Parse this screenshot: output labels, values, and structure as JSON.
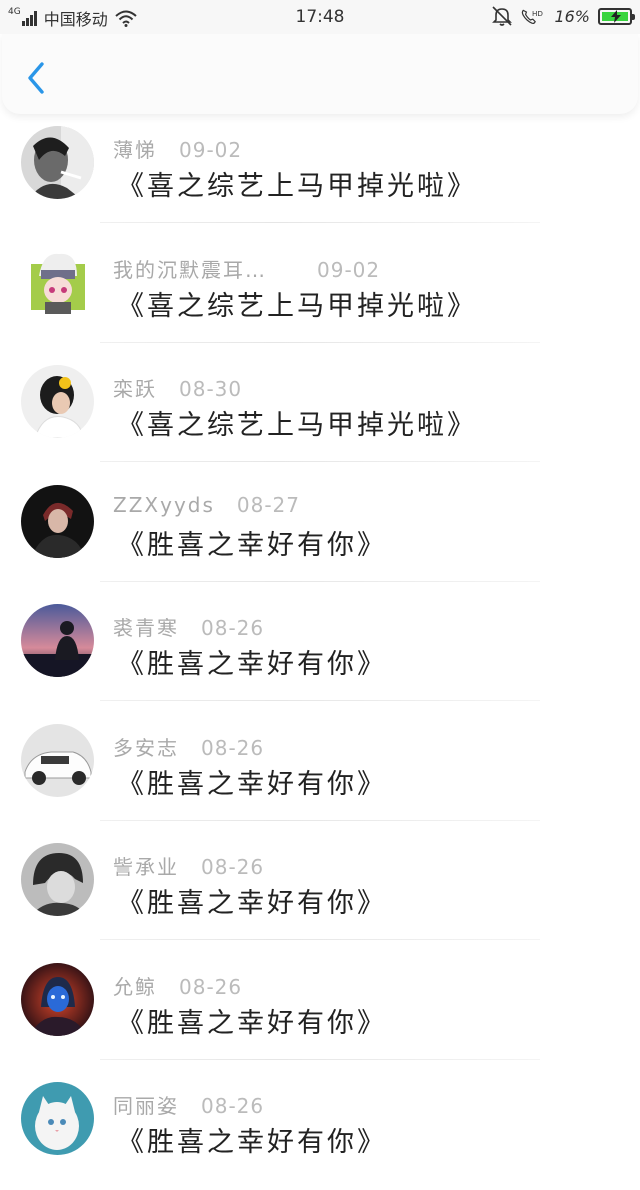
{
  "status_bar": {
    "network_type": "4G",
    "carrier": "中国移动",
    "time": "17:48",
    "battery_percent": "16%",
    "icons": [
      "signal-icon",
      "wifi-icon",
      "mute-icon",
      "call-hd-icon",
      "battery-charging-icon"
    ]
  },
  "nav": {
    "back_icon": "chevron-left-icon"
  },
  "colors": {
    "accent": "#2a96e8",
    "meta_text": "#a9a9a9",
    "title_text": "#222222"
  },
  "comments": [
    {
      "name": "薄悌",
      "date": "09-02",
      "title": "《喜之综艺上马甲掉光啦》"
    },
    {
      "name": "我的沉默震耳…",
      "date": "09-02",
      "title": "《喜之综艺上马甲掉光啦》"
    },
    {
      "name": "栾跃",
      "date": "08-30",
      "title": "《喜之综艺上马甲掉光啦》"
    },
    {
      "name": "ZZXyyds",
      "date": "08-27",
      "title": "《胜喜之幸好有你》"
    },
    {
      "name": "裘青寒",
      "date": "08-26",
      "title": "《胜喜之幸好有你》"
    },
    {
      "name": "多安志",
      "date": "08-26",
      "title": "《胜喜之幸好有你》"
    },
    {
      "name": "訾承业",
      "date": "08-26",
      "title": "《胜喜之幸好有你》"
    },
    {
      "name": "允鲸",
      "date": "08-26",
      "title": "《胜喜之幸好有你》"
    },
    {
      "name": "同丽姿",
      "date": "08-26",
      "title": "《胜喜之幸好有你》"
    }
  ]
}
